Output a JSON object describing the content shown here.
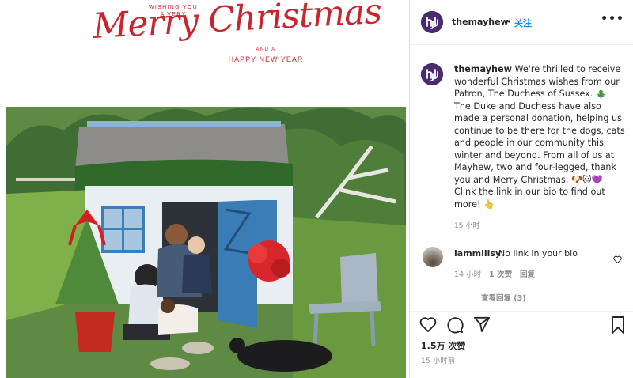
{
  "card": {
    "wishing_line1": "WISHING YOU",
    "wishing_line2": "A VERY",
    "headline": "Merry Christmas",
    "and_a": "AND A",
    "happy_new_year": "HAPPY NEW YEAR"
  },
  "header": {
    "username": "themayhew",
    "separator": "•",
    "follow_label": "关注",
    "more_label": "•••"
  },
  "caption": {
    "username": "themayhew",
    "text": "We're thrilled to receive wonderful Christmas wishes from our Patron, The Duchess of Sussex. 🎄 The Duke and Duchess have also made a personal donation, helping us continue to be there for the dogs, cats and people in our community this winter and beyond. From all of us at Mayhew, two and four-legged, thank you and Merry Christmas. 🐶🐱💜 Clink the link in our bio to find out more! 👆",
    "time": "15 小时"
  },
  "comment": {
    "username": "iammilisy",
    "text": "No link in your bio",
    "time": "14 小时",
    "likes": "1 次赞",
    "reply_label": "回复",
    "view_replies": "查看回复 (3)"
  },
  "post": {
    "likes": "1.5万 次赞",
    "time": "15 小时前"
  },
  "icons": {
    "heart": "heart-icon",
    "comment": "comment-icon",
    "share": "share-icon",
    "bookmark": "bookmark-icon",
    "more": "more-icon"
  },
  "colors": {
    "accent_red": "#c8262f",
    "link_blue": "#0095f6",
    "avatar_purple": "#4a2b6f",
    "muted_gray": "#8e8e8e"
  }
}
